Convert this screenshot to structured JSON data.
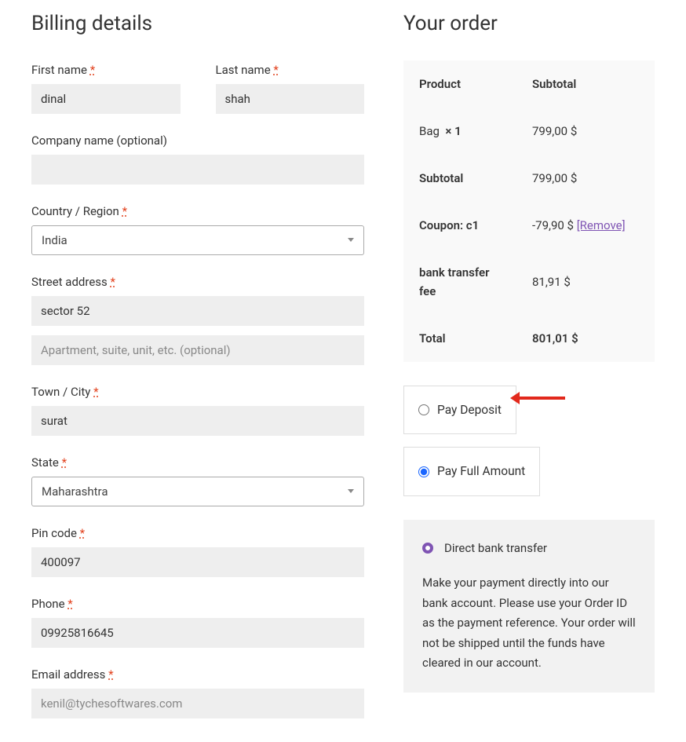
{
  "billing": {
    "heading": "Billing details",
    "first_name": {
      "label": "First name",
      "value": "dinal"
    },
    "last_name": {
      "label": "Last name",
      "value": "shah"
    },
    "company": {
      "label": "Company name (optional)",
      "value": ""
    },
    "country": {
      "label": "Country / Region",
      "value": "India"
    },
    "street": {
      "label": "Street address",
      "value": "sector 52",
      "placeholder2": "Apartment, suite, unit, etc. (optional)"
    },
    "city": {
      "label": "Town / City",
      "value": "surat"
    },
    "state": {
      "label": "State",
      "value": "Maharashtra"
    },
    "pin": {
      "label": "Pin code",
      "value": "400097"
    },
    "phone": {
      "label": "Phone",
      "value": "09925816645"
    },
    "email": {
      "label": "Email address",
      "value": "kenil@tychesoftwares.com"
    }
  },
  "order": {
    "heading": "Your order",
    "headers": {
      "product": "Product",
      "subtotal": "Subtotal"
    },
    "item": {
      "name": "Bag",
      "qty": "× 1",
      "price": "799,00 $"
    },
    "subtotal": {
      "label": "Subtotal",
      "value": "799,00 $"
    },
    "coupon": {
      "label": "Coupon: c1",
      "value": "-79,90 $",
      "remove": "[Remove]"
    },
    "fee": {
      "label": "bank transfer fee",
      "value": "81,91 $"
    },
    "total": {
      "label": "Total",
      "value": "801,01 $"
    },
    "pay_deposit": "Pay Deposit",
    "pay_full": "Pay Full Amount",
    "payment_method": "Direct bank transfer",
    "payment_desc": "Make your payment directly into our bank account. Please use your Order ID as the payment reference. Your order will not be shipped until the funds have cleared in our account."
  }
}
